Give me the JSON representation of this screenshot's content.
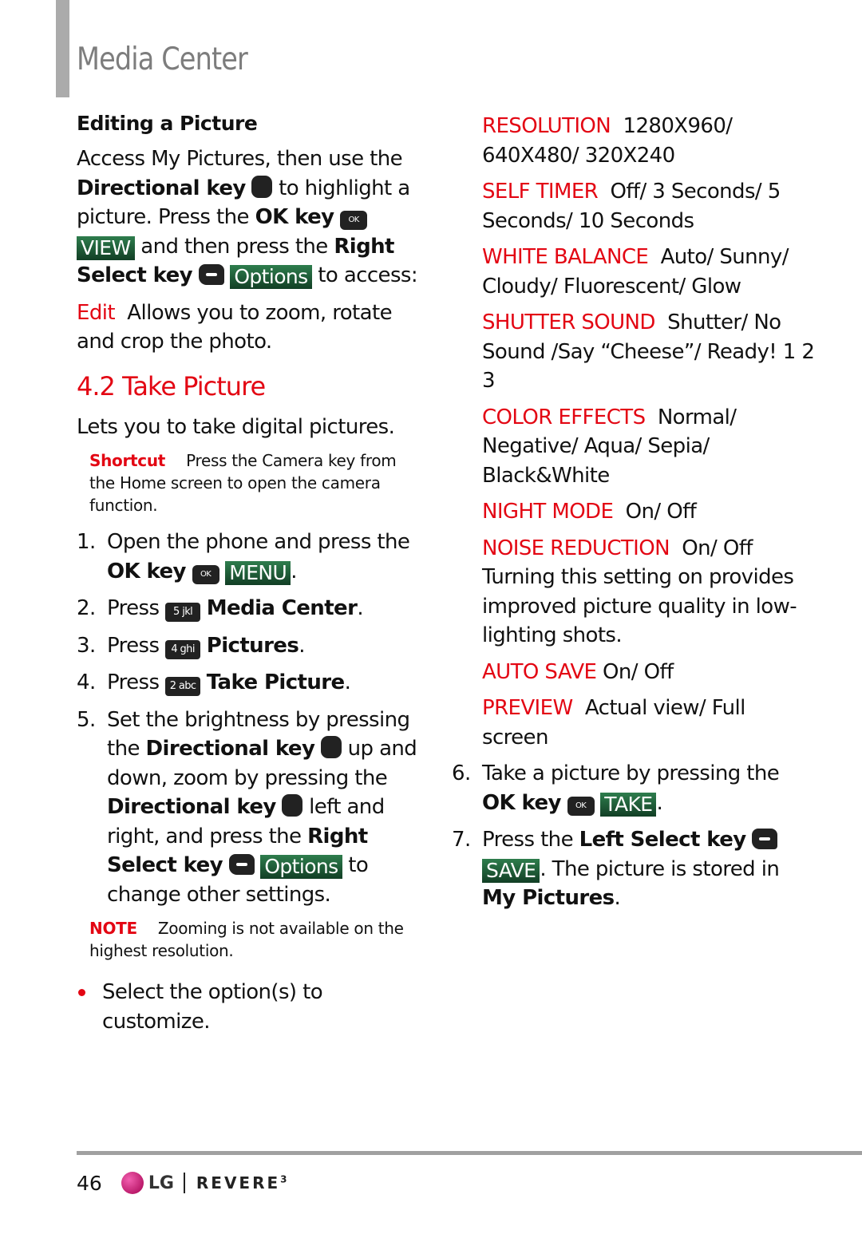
{
  "header": {
    "title": "Media Center"
  },
  "left": {
    "subheading": "Editing a Picture",
    "intro": {
      "p1": "Access My Pictures, then use the",
      "dir_key": "Directional key",
      "p2": " to highlight a picture. Press the ",
      "ok_key": "OK key",
      "view_label": "VIEW",
      "p3": " and then press the ",
      "right_select": "Right Select key",
      "options_label": "Options",
      "p4": " to access:"
    },
    "edit": {
      "label": "Edit",
      "text": "Allows you to zoom, rotate and crop the photo."
    },
    "section_title": "4.2 Take Picture",
    "section_desc": "Lets you to take digital pictures.",
    "shortcut": {
      "label": "Shortcut",
      "text": "Press the Camera key  from the Home screen to open the camera function."
    },
    "steps": [
      {
        "num": "1.",
        "pre": "Open the phone and press the ",
        "bold": "OK key",
        "key": "OK",
        "green": "MENU",
        "post": "."
      },
      {
        "num": "2.",
        "pre": "Press ",
        "key": "5 jkl",
        "bold": "Media Center",
        "post": "."
      },
      {
        "num": "3.",
        "pre": "Press ",
        "key": "4 ghi",
        "bold": "Pictures",
        "post": "."
      },
      {
        "num": "4.",
        "pre": "Press ",
        "key": "2 abc",
        "bold": "Take Picture",
        "post": "."
      },
      {
        "num": "5.",
        "a": "Set the brightness by pressing the ",
        "b": "Directional key",
        "c": " up and down, zoom by pressing the ",
        "d": "Directional key",
        "e": " left and right, and press the ",
        "f": "Right Select key",
        "green": "Options",
        "g": " to change other settings."
      }
    ],
    "note": {
      "label": "NOTE",
      "text": "Zooming is not available on the highest resolution."
    },
    "bullet": "Select the option(s) to customize."
  },
  "right": {
    "options": [
      {
        "label": "RESOLUTION",
        "value": "1280X960/ 640X480/ 320X240"
      },
      {
        "label": "SELF TIMER",
        "value": "Off/ 3 Seconds/ 5 Seconds/ 10 Seconds"
      },
      {
        "label": "WHITE BALANCE",
        "value": "Auto/ Sunny/ Cloudy/ Fluorescent/ Glow"
      },
      {
        "label": "SHUTTER SOUND",
        "value": "Shutter/ No Sound /Say “Cheese”/ Ready! 1 2 3"
      },
      {
        "label": "COLOR EFFECTS",
        "value": "Normal/ Negative/ Aqua/ Sepia/ Black&White"
      },
      {
        "label": "NIGHT MODE",
        "value": "On/ Off"
      },
      {
        "label": "NOISE REDUCTION",
        "value": "On/ Off Turning this setting on provides improved picture quality in low-lighting shots."
      },
      {
        "label": "AUTO SAVE",
        "value": "On/ Off"
      },
      {
        "label": "PREVIEW",
        "value": "Actual view/ Full screen"
      }
    ],
    "steps": [
      {
        "num": "6.",
        "pre": "Take a picture by pressing the ",
        "bold": "OK key",
        "key": "OK",
        "green": "TAKE",
        "post": "."
      },
      {
        "num": "7.",
        "pre": "Press the ",
        "bold": "Left Select key",
        "green": "SAVE",
        "post": ". The picture is stored in ",
        "bold2": "My Pictures",
        "post2": "."
      }
    ]
  },
  "footer": {
    "page_number": "46",
    "brand": "LG",
    "product": "REVERE",
    "product_suffix": "3"
  },
  "colors": {
    "accent_red": "#e30613",
    "key_green": "#1f5c38",
    "title_gray": "#7d7d7d"
  }
}
